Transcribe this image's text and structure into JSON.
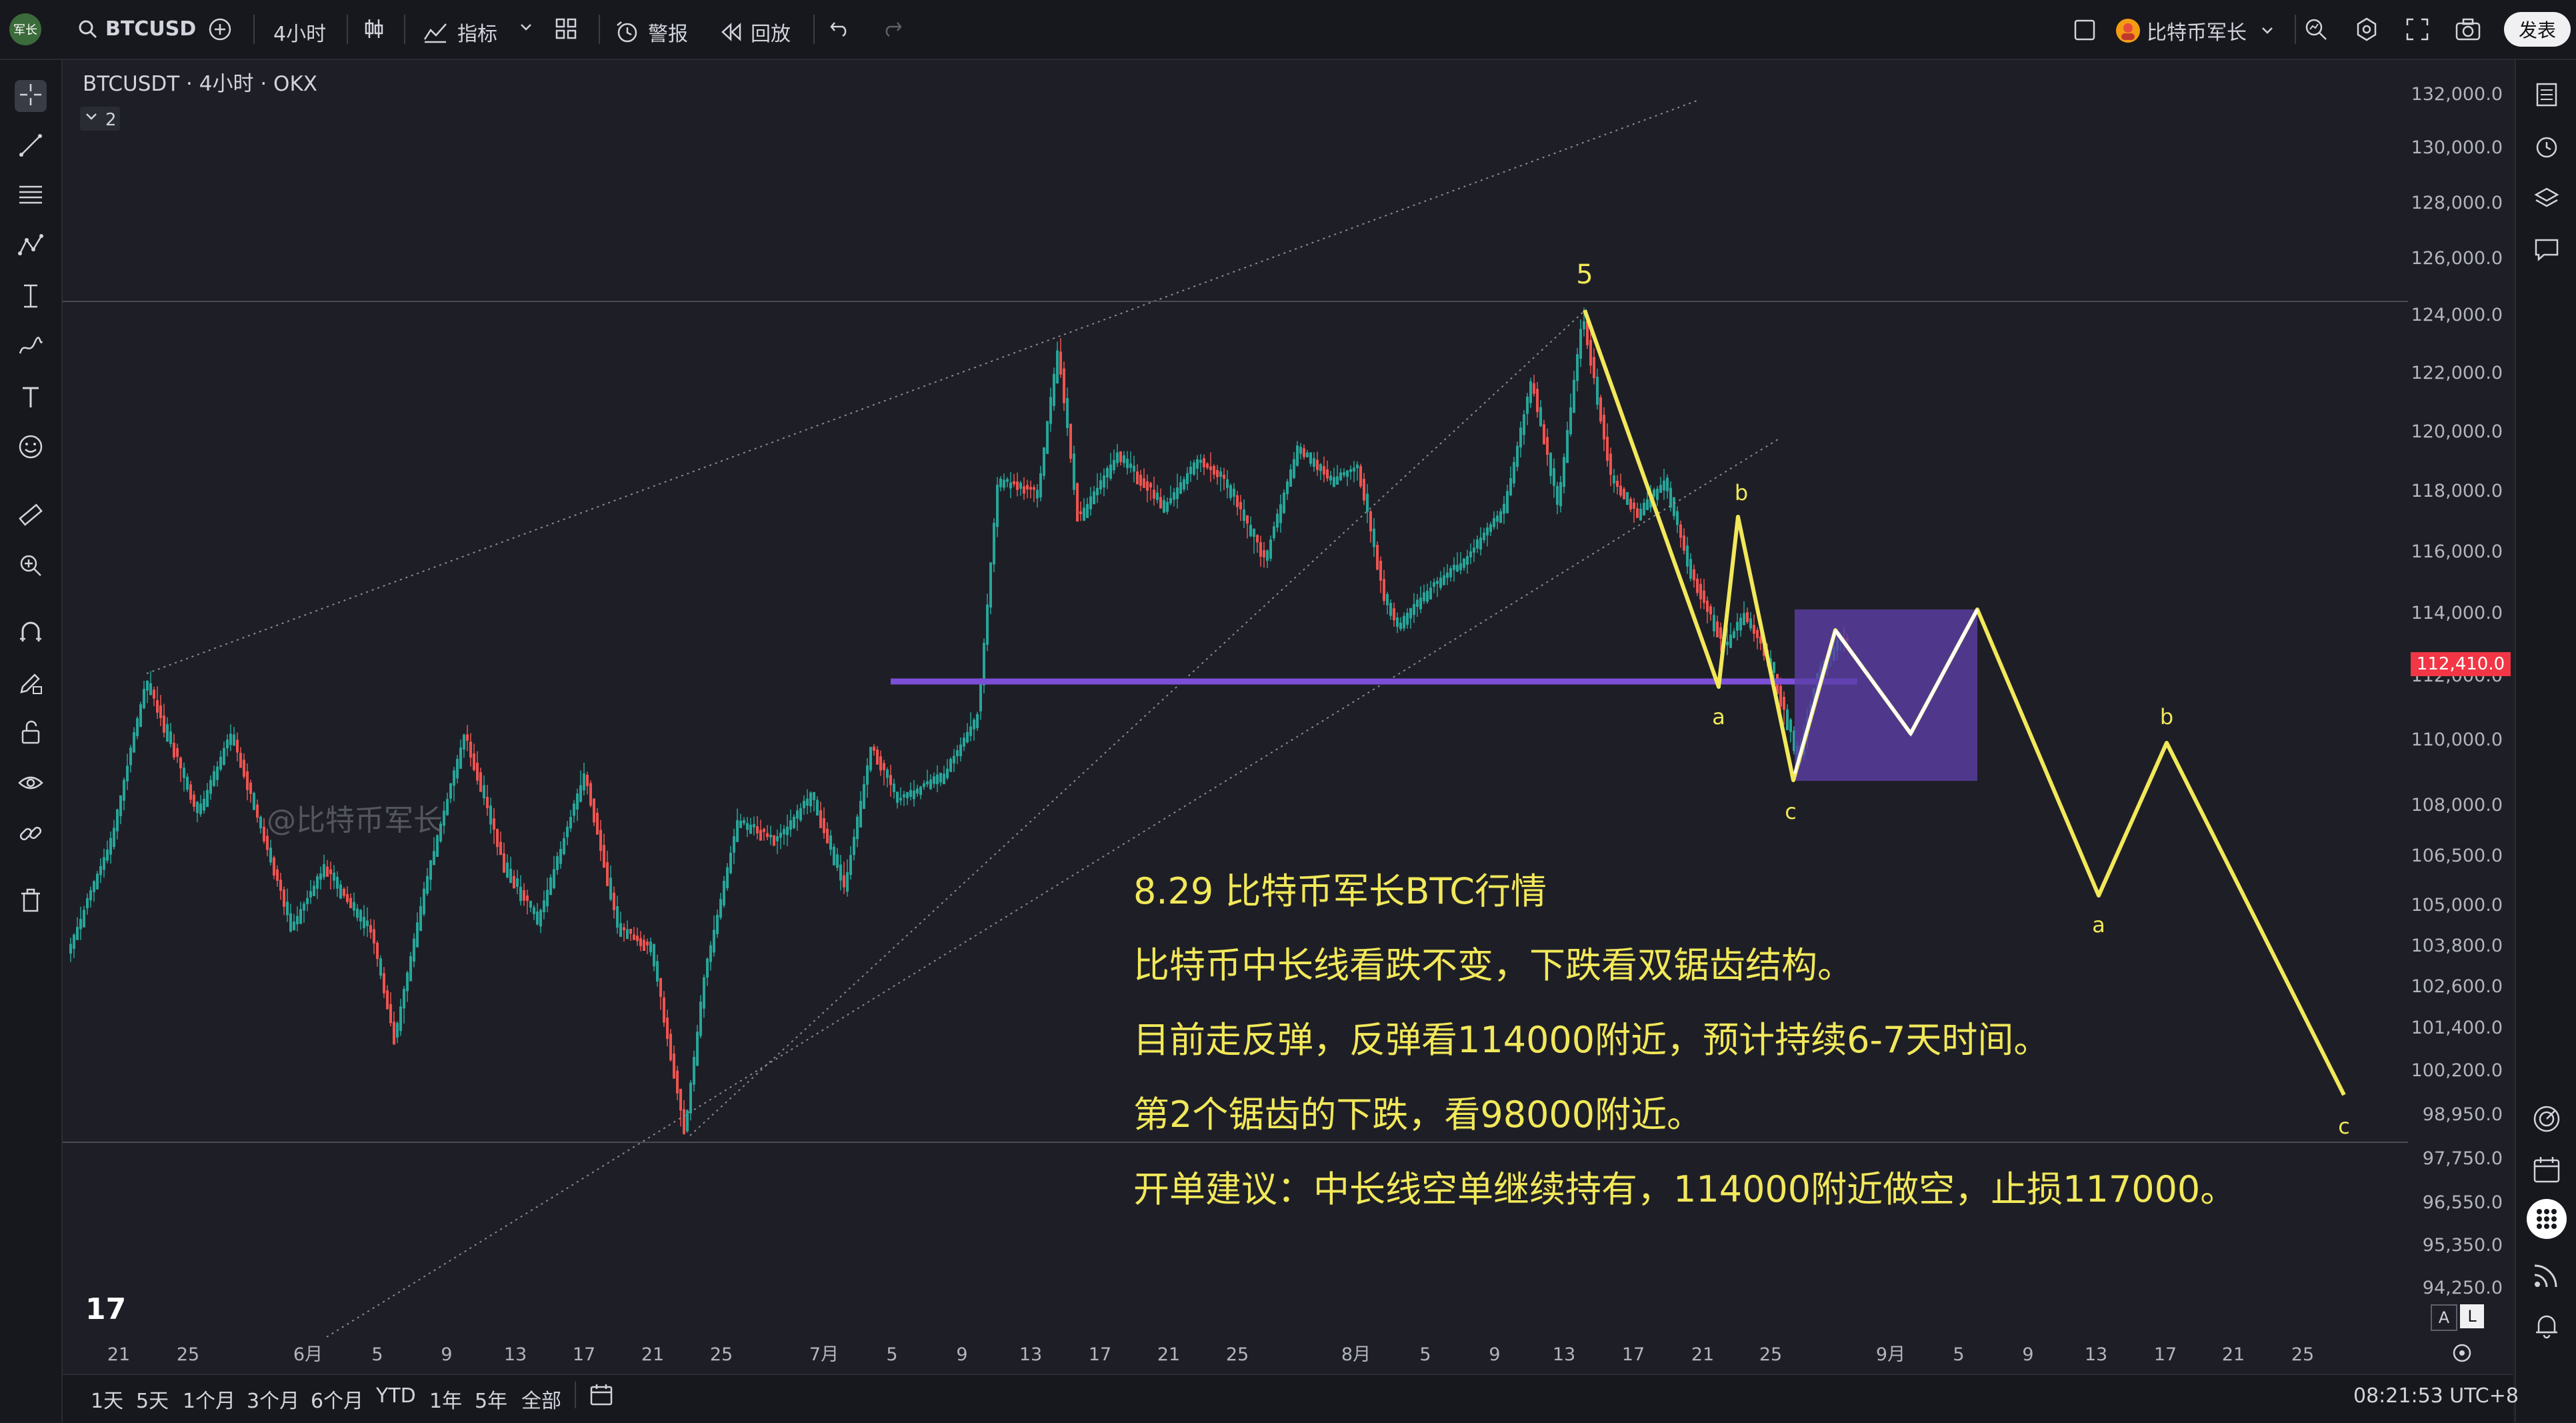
{
  "toolbar": {
    "app_logo": "军长",
    "symbol": "BTCUSD",
    "interval": "4小时",
    "indicators": "指标",
    "alert": "警报",
    "replay": "回放",
    "account_name": "比特币军长",
    "publish": "发表"
  },
  "chart": {
    "legend_title": "BTCUSDT · 4小时 · OKX",
    "legend_collapse": "2",
    "watermark": "@比特币军长",
    "current_price": "112,410.0",
    "price_ticks": [
      "132,000.0",
      "130,000.0",
      "128,000.0",
      "126,000.0",
      "124,000.0",
      "122,000.0",
      "120,000.0",
      "118,000.0",
      "116,000.0",
      "114,000.0",
      "112,000.0",
      "110,000.0",
      "108,000.0",
      "106,500.0",
      "105,000.0",
      "103,800.0",
      "102,600.0",
      "101,400.0",
      "100,200.0",
      "98,950.0",
      "97,750.0",
      "96,550.0",
      "95,350.0",
      "94,250.0"
    ],
    "time_ticks": [
      "21",
      "25",
      "6月",
      "5",
      "9",
      "13",
      "17",
      "21",
      "25",
      "7月",
      "5",
      "9",
      "13",
      "17",
      "21",
      "25",
      "8月",
      "5",
      "9",
      "13",
      "17",
      "21",
      "25",
      "9月",
      "5",
      "9",
      "13",
      "17",
      "21",
      "25"
    ],
    "wave_labels": [
      "5",
      "b",
      "a",
      "c",
      "b",
      "a",
      "c"
    ],
    "annotation_lines": [
      "8.29 比特币军长BTC行情",
      "比特币中长线看跌不变，下跌看双锯齿结构。",
      "目前走反弹，反弹看114000附近，预计持续6-7天时间。",
      "第2个锯齿的下跌，看98000附近。",
      "开单建议：中长线空单继续持有，114000附近做空，止损117000。"
    ],
    "scale_a": "A",
    "scale_l": "L",
    "colors": {
      "up": "#26a69a",
      "down": "#ef5350",
      "projection": "#f2e85a",
      "zone": "#5b3fa6",
      "hline": "#7b4fd8",
      "price_tag": "#f23645"
    }
  },
  "bottom": {
    "ranges": [
      "1天",
      "5天",
      "1个月",
      "3个月",
      "6个月",
      "YTD",
      "1年",
      "5年",
      "全部"
    ],
    "clock": "08:21:53 UTC+8"
  }
}
